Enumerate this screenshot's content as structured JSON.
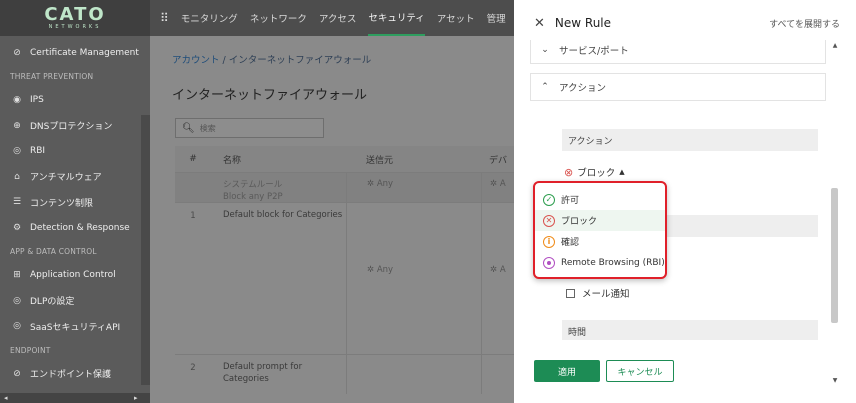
{
  "sidebar": {
    "logo_main": "CATO",
    "logo_sub": "NETWORKS",
    "items_top": [
      {
        "icon": "⊘",
        "label": "Certificate Management"
      }
    ],
    "section_threat": "THREAT PREVENTION",
    "items_threat": [
      {
        "icon": "◉",
        "label": "IPS"
      },
      {
        "icon": "⊕",
        "label": "DNSプロテクション"
      },
      {
        "icon": "◎",
        "label": "RBI"
      },
      {
        "icon": "⌂",
        "label": "アンチマルウェア"
      },
      {
        "icon": "☰",
        "label": "コンテンツ制限"
      },
      {
        "icon": "⚙",
        "label": "Detection & Response"
      }
    ],
    "section_app": "APP & DATA CONTROL",
    "items_app": [
      {
        "icon": "⊞",
        "label": "Application Control"
      },
      {
        "icon": "◎",
        "label": "DLPの設定"
      },
      {
        "icon": "◎",
        "label": "SaaSセキュリティAPI"
      }
    ],
    "section_endpoint": "ENDPOINT",
    "items_endpoint": [
      {
        "icon": "⊘",
        "label": "エンドポイント保護"
      }
    ]
  },
  "topnav": {
    "tabs": [
      "モニタリング",
      "ネットワーク",
      "アクセス",
      "セキュリティ",
      "アセット",
      "管理"
    ]
  },
  "main": {
    "breadcrumb_link": "アカウント",
    "breadcrumb_sep": " / ",
    "breadcrumb_current": "インターネットファイアウォール",
    "title": "インターネットファイアウォール",
    "search_placeholder": "検索",
    "table": {
      "headers": [
        "#",
        "名称",
        "送信元",
        "デバ"
      ],
      "rows": [
        {
          "num": "",
          "name_line1": "システムルール",
          "name_line2": "Block any P2P",
          "src": "✲ Any",
          "dev": "✲ A"
        },
        {
          "num": "1",
          "name_line1": "Default block for Categories",
          "name_line2": "",
          "src": "✲ Any",
          "dev": "✲ A"
        },
        {
          "num": "2",
          "name_line1": "Default prompt for",
          "name_line2": "Categories",
          "src": "",
          "dev": ""
        }
      ]
    }
  },
  "panel": {
    "title": "New Rule",
    "expand_all": "すべてを展開する",
    "section_service": "サービス/ポート",
    "section_action": "アクション",
    "action_label": "アクション",
    "action_selected": "ブロック",
    "dropdown": [
      {
        "key": "allow",
        "label": "許可"
      },
      {
        "key": "block",
        "label": "ブロック"
      },
      {
        "key": "prompt",
        "label": "確認"
      },
      {
        "key": "rbi",
        "label": "Remote Browsing (RBI)"
      }
    ],
    "email_label": "メール通知",
    "time_label": "時間",
    "apply": "適用",
    "cancel": "キャンセル"
  },
  "colors": {
    "accent_green": "#1d8c55",
    "highlight_red": "#e0202a",
    "allow": "#2e9e4f",
    "block": "#d9534f",
    "prompt": "#f08c1a",
    "rbi": "#b14fc2"
  }
}
